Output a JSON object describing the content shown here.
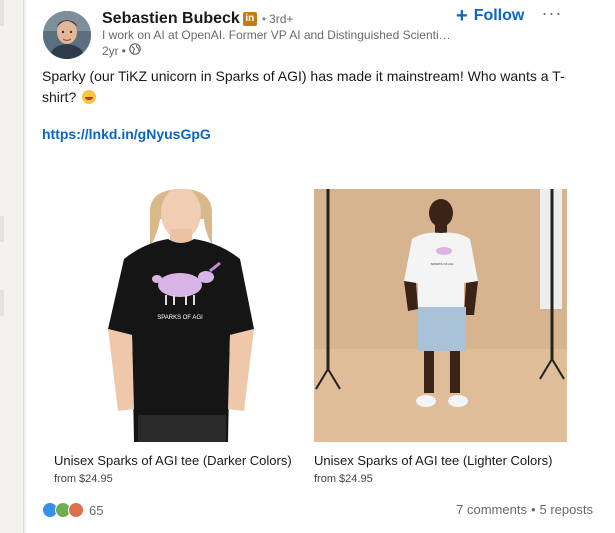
{
  "post": {
    "author": {
      "name": "Sebastien Bubeck",
      "badge": "in",
      "degree": "3rd+",
      "headline": "I work on AI at OpenAI. Former VP AI and Distinguished Scientist at Microsoft.",
      "time": "2yr"
    },
    "follow_label": "Follow",
    "more_label": "···",
    "text": "Sparky (our TiKZ unicorn in Sparks of AGI) has made it mainstream! Who wants a T-shirt?",
    "link": "https://lnkd.in/gNyusGpG",
    "products": [
      {
        "title": "Unisex Sparks of AGI tee (Darker Colors)",
        "price": "from $24.95",
        "shirt_print": "SPARKS OF AGI",
        "shirt_color": "#151515",
        "bg_color": "#ffffff"
      },
      {
        "title": "Unisex Sparks of AGI tee (Lighter Colors)",
        "price": "from $24.95",
        "shirt_print": "SPARKS OF AGI",
        "shirt_color": "#f4f4f4",
        "bg_color": "#d6b48f"
      }
    ],
    "reactions": {
      "count": "65",
      "icons": [
        "like-icon",
        "support-icon",
        "love-icon"
      ]
    },
    "comments": "7 comments",
    "reposts": "5 reposts"
  },
  "colors": {
    "link": "#0a66c2",
    "premium_badge": "#c37d16",
    "like": "#378fe9",
    "support": "#6dae4f",
    "love": "#df704d"
  }
}
